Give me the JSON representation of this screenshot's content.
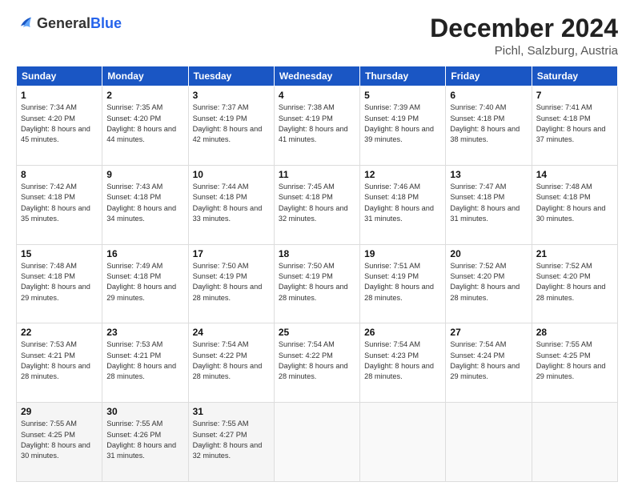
{
  "header": {
    "logo_general": "General",
    "logo_blue": "Blue",
    "month": "December 2024",
    "location": "Pichl, Salzburg, Austria"
  },
  "weekdays": [
    "Sunday",
    "Monday",
    "Tuesday",
    "Wednesday",
    "Thursday",
    "Friday",
    "Saturday"
  ],
  "weeks": [
    [
      {
        "day": "1",
        "sunrise": "7:34 AM",
        "sunset": "4:20 PM",
        "daylight": "8 hours and 45 minutes."
      },
      {
        "day": "2",
        "sunrise": "7:35 AM",
        "sunset": "4:20 PM",
        "daylight": "8 hours and 44 minutes."
      },
      {
        "day": "3",
        "sunrise": "7:37 AM",
        "sunset": "4:19 PM",
        "daylight": "8 hours and 42 minutes."
      },
      {
        "day": "4",
        "sunrise": "7:38 AM",
        "sunset": "4:19 PM",
        "daylight": "8 hours and 41 minutes."
      },
      {
        "day": "5",
        "sunrise": "7:39 AM",
        "sunset": "4:19 PM",
        "daylight": "8 hours and 39 minutes."
      },
      {
        "day": "6",
        "sunrise": "7:40 AM",
        "sunset": "4:18 PM",
        "daylight": "8 hours and 38 minutes."
      },
      {
        "day": "7",
        "sunrise": "7:41 AM",
        "sunset": "4:18 PM",
        "daylight": "8 hours and 37 minutes."
      }
    ],
    [
      {
        "day": "8",
        "sunrise": "7:42 AM",
        "sunset": "4:18 PM",
        "daylight": "8 hours and 35 minutes."
      },
      {
        "day": "9",
        "sunrise": "7:43 AM",
        "sunset": "4:18 PM",
        "daylight": "8 hours and 34 minutes."
      },
      {
        "day": "10",
        "sunrise": "7:44 AM",
        "sunset": "4:18 PM",
        "daylight": "8 hours and 33 minutes."
      },
      {
        "day": "11",
        "sunrise": "7:45 AM",
        "sunset": "4:18 PM",
        "daylight": "8 hours and 32 minutes."
      },
      {
        "day": "12",
        "sunrise": "7:46 AM",
        "sunset": "4:18 PM",
        "daylight": "8 hours and 31 minutes."
      },
      {
        "day": "13",
        "sunrise": "7:47 AM",
        "sunset": "4:18 PM",
        "daylight": "8 hours and 31 minutes."
      },
      {
        "day": "14",
        "sunrise": "7:48 AM",
        "sunset": "4:18 PM",
        "daylight": "8 hours and 30 minutes."
      }
    ],
    [
      {
        "day": "15",
        "sunrise": "7:48 AM",
        "sunset": "4:18 PM",
        "daylight": "8 hours and 29 minutes."
      },
      {
        "day": "16",
        "sunrise": "7:49 AM",
        "sunset": "4:18 PM",
        "daylight": "8 hours and 29 minutes."
      },
      {
        "day": "17",
        "sunrise": "7:50 AM",
        "sunset": "4:19 PM",
        "daylight": "8 hours and 28 minutes."
      },
      {
        "day": "18",
        "sunrise": "7:50 AM",
        "sunset": "4:19 PM",
        "daylight": "8 hours and 28 minutes."
      },
      {
        "day": "19",
        "sunrise": "7:51 AM",
        "sunset": "4:19 PM",
        "daylight": "8 hours and 28 minutes."
      },
      {
        "day": "20",
        "sunrise": "7:52 AM",
        "sunset": "4:20 PM",
        "daylight": "8 hours and 28 minutes."
      },
      {
        "day": "21",
        "sunrise": "7:52 AM",
        "sunset": "4:20 PM",
        "daylight": "8 hours and 28 minutes."
      }
    ],
    [
      {
        "day": "22",
        "sunrise": "7:53 AM",
        "sunset": "4:21 PM",
        "daylight": "8 hours and 28 minutes."
      },
      {
        "day": "23",
        "sunrise": "7:53 AM",
        "sunset": "4:21 PM",
        "daylight": "8 hours and 28 minutes."
      },
      {
        "day": "24",
        "sunrise": "7:54 AM",
        "sunset": "4:22 PM",
        "daylight": "8 hours and 28 minutes."
      },
      {
        "day": "25",
        "sunrise": "7:54 AM",
        "sunset": "4:22 PM",
        "daylight": "8 hours and 28 minutes."
      },
      {
        "day": "26",
        "sunrise": "7:54 AM",
        "sunset": "4:23 PM",
        "daylight": "8 hours and 28 minutes."
      },
      {
        "day": "27",
        "sunrise": "7:54 AM",
        "sunset": "4:24 PM",
        "daylight": "8 hours and 29 minutes."
      },
      {
        "day": "28",
        "sunrise": "7:55 AM",
        "sunset": "4:25 PM",
        "daylight": "8 hours and 29 minutes."
      }
    ],
    [
      {
        "day": "29",
        "sunrise": "7:55 AM",
        "sunset": "4:25 PM",
        "daylight": "8 hours and 30 minutes."
      },
      {
        "day": "30",
        "sunrise": "7:55 AM",
        "sunset": "4:26 PM",
        "daylight": "8 hours and 31 minutes."
      },
      {
        "day": "31",
        "sunrise": "7:55 AM",
        "sunset": "4:27 PM",
        "daylight": "8 hours and 32 minutes."
      },
      null,
      null,
      null,
      null
    ]
  ]
}
